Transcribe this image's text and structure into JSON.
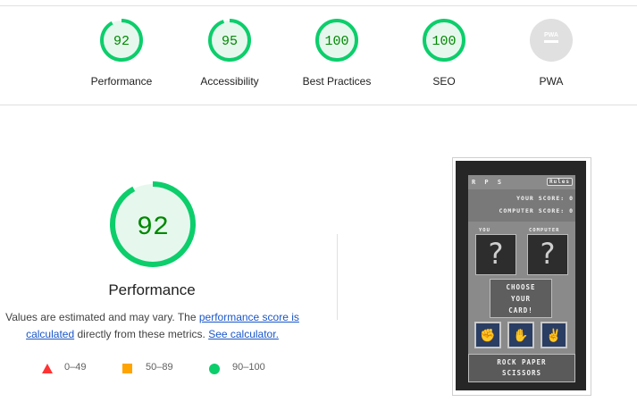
{
  "colors": {
    "pass": "#0cce6b",
    "pass_text": "#008800",
    "pass_fill": "#e6f8ee",
    "average": "#ffa400",
    "fail": "#ff3333",
    "pwa_gray": "#e0e0e0",
    "link": "#1a56c9"
  },
  "categories": [
    {
      "score": "92",
      "value": 92,
      "label": "Performance"
    },
    {
      "score": "95",
      "value": 95,
      "label": "Accessibility"
    },
    {
      "score": "100",
      "value": 100,
      "label": "Best Practices"
    },
    {
      "score": "100",
      "value": 100,
      "label": "SEO"
    },
    {
      "score": "",
      "value": null,
      "label": "PWA",
      "icon_text": "PWA"
    }
  ],
  "performance": {
    "score": "92",
    "value": 92,
    "title": "Performance",
    "desc_prefix": "Values are estimated and may vary. The ",
    "desc_link1": "performance score is calculated",
    "desc_middle": " directly from these metrics. ",
    "desc_link2": "See calculator."
  },
  "legend": [
    {
      "range": "0–49",
      "icon": "triangle-icon"
    },
    {
      "range": "50–89",
      "icon": "square-icon"
    },
    {
      "range": "90–100",
      "icon": "circle-icon"
    }
  ],
  "screenshot": {
    "title": "R P S",
    "rules_label": "Rules",
    "your_score": "YOUR SCORE: 0",
    "computer_score": "COMPUTER SCORE: 0",
    "you_label": "YOU",
    "computer_label": "COMPUTER",
    "choose_text": "CHOOSE YOUR CARD!",
    "choose_lines": [
      "CHOOSE",
      "YOUR",
      "CARD!"
    ],
    "banner_lines": [
      "ROCK PAPER",
      "SCISSORS"
    ]
  }
}
